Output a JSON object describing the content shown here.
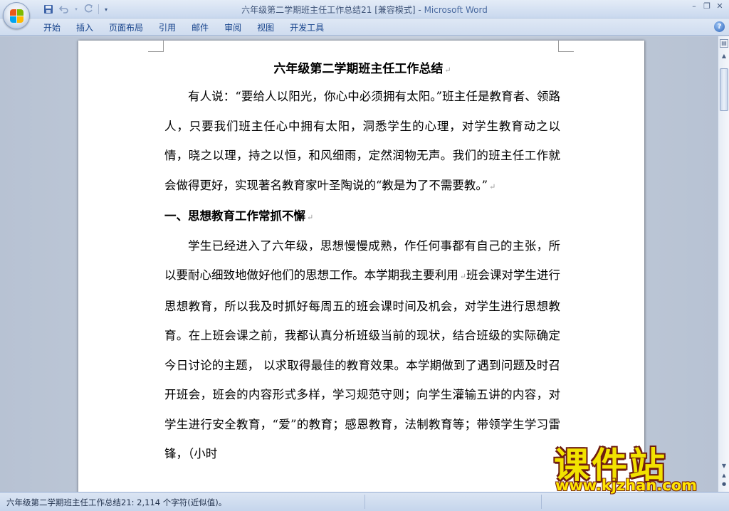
{
  "window": {
    "title_doc": "六年级第二学期班主任工作总结21 [兼容模式]",
    "title_sep": " - ",
    "title_app": "Microsoft Word",
    "minimize_glyph": "–",
    "restore_glyph": "❐",
    "close_glyph": "✕"
  },
  "quick_access": {
    "save_icon": "save-icon",
    "undo_icon": "undo-icon",
    "redo_icon": "redo-icon",
    "customize_icon": "dropdown-icon"
  },
  "ribbon": {
    "tabs": [
      {
        "label": "开始"
      },
      {
        "label": "插入"
      },
      {
        "label": "页面布局"
      },
      {
        "label": "引用"
      },
      {
        "label": "邮件"
      },
      {
        "label": "审阅"
      },
      {
        "label": "视图"
      },
      {
        "label": "开发工具"
      }
    ],
    "help_glyph": "?"
  },
  "document": {
    "title": "六年级第二学期班主任工作总结",
    "paragraph1": "有人说：“要给人以阳光，你心中必须拥有太阳。”班主任是教育者、领路人，只要我们班主任心中拥有太阳，洞悉学生的心理，对学生教育动之以情，晓之以理，持之以恒，和风细雨，定然润物无声。我们的班主任工作就会做得更好，实现著名教育家叶圣陶说的“教是为了不需要教。”",
    "heading1": "一、思想教育工作常抓不懈",
    "paragraph2_part1": "学生已经进入了六年级，思想慢慢成熟，作任何事都有自己的主张，所以要耐心细致地做好他们的思想工作。本学期我主要利用",
    "paragraph2_part2": "班会课对学生进行思想教育，所以我及时抓好每周五的班会课时间及机会，对学生进行思想教育。在上班会课之前，我都认真分析班级当前的现状，结合班级的实际确定今日讨论的主题， 以求取得最佳的教育效果。本学期做到了遇到问题及时召开班会，班会的内容形式多样，学习规范守则；向学生灌输五讲的内容，对学生进行安全教育，“爱”的教育；感恩教育，法制教育等；带领学生学习雷锋，（小时",
    "paragraph_mark": "↵"
  },
  "statusbar": {
    "text": "六年级第二学期班主任工作总结21: 2,114 个字符(近似值)。"
  },
  "watermark": {
    "title": "课件站",
    "url": "www.kjzhan.com"
  }
}
